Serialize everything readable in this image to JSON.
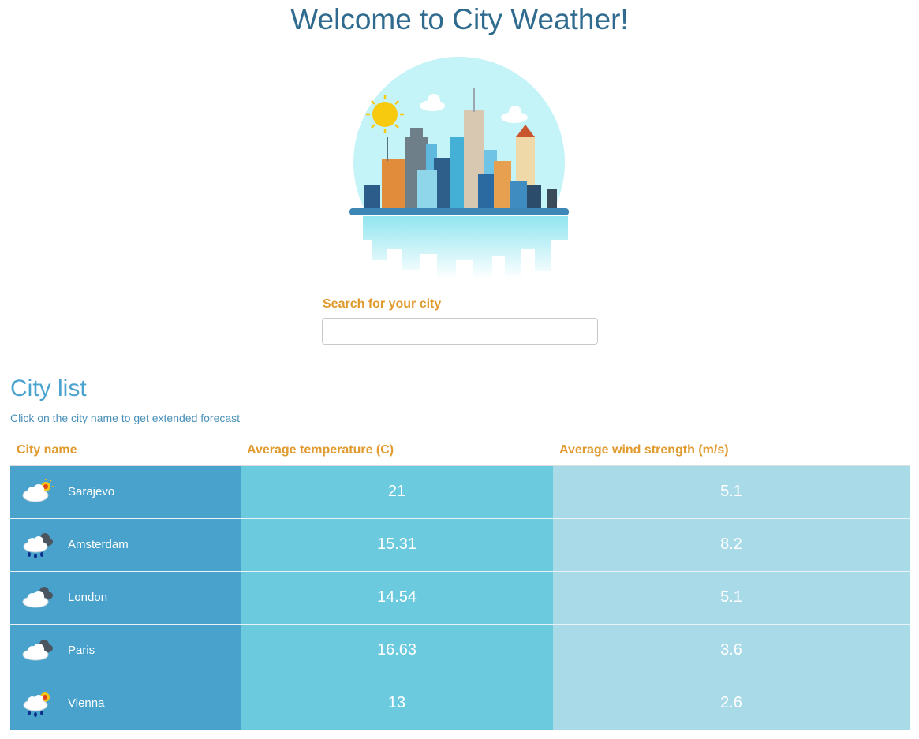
{
  "page": {
    "title": "Welcome to City Weather!"
  },
  "hero": {
    "image": "city-skyline-illustration",
    "alt": "city-skyline-icon"
  },
  "search": {
    "label": "Search for your city",
    "value": "",
    "placeholder": ""
  },
  "city_list": {
    "title": "City list",
    "subtitle": "Click on the city name to get extended forecast",
    "columns": [
      "City name",
      "Average temperature (C)",
      "Average wind strength (m/s)"
    ],
    "rows": [
      {
        "icon": "sun-behind-cloud-icon",
        "name": "Sarajevo",
        "temperature": "21",
        "wind": "5.1"
      },
      {
        "icon": "cloud-rain-icon",
        "name": "Amsterdam",
        "temperature": "15.31",
        "wind": "8.2"
      },
      {
        "icon": "overcast-clouds-icon",
        "name": "London",
        "temperature": "14.54",
        "wind": "5.1"
      },
      {
        "icon": "overcast-clouds-icon",
        "name": "Paris",
        "temperature": "16.63",
        "wind": "3.6"
      },
      {
        "icon": "sun-rain-cloud-icon",
        "name": "Vienna",
        "temperature": "13",
        "wind": "2.6"
      }
    ]
  },
  "colors": {
    "title": "#2f6a8f",
    "label_orange": "#e09a2e",
    "name_column": "#48a2cc",
    "temp_column": "#6ccadf",
    "wind_column": "#a9dae8"
  }
}
